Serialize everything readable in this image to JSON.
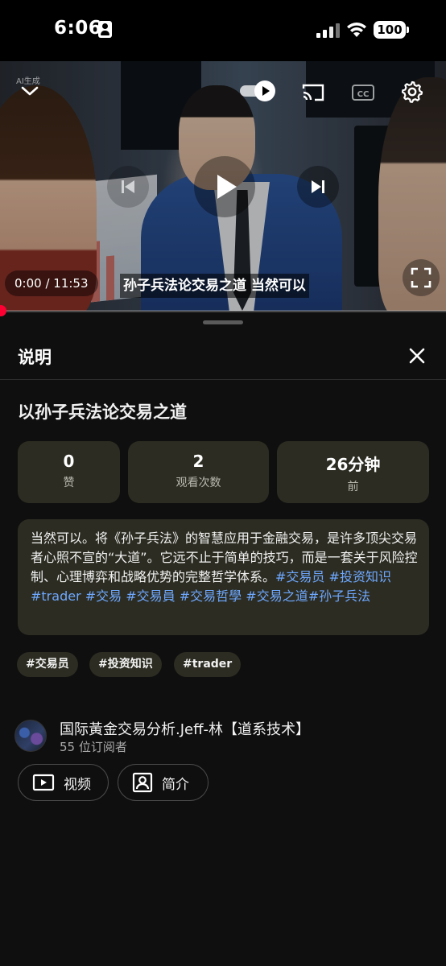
{
  "status_bar": {
    "time": "6:06",
    "battery": "100"
  },
  "player": {
    "ai_label": "AI生成",
    "time_display": "0:00 / 11:53",
    "subtitle": "孙子兵法论交易之道 当然可以",
    "progress": 0
  },
  "sheet": {
    "title": "说明",
    "video_title": "以孙子兵法论交易之道",
    "stats": [
      {
        "value": "0",
        "label": "赞"
      },
      {
        "value": "2",
        "label": "观看次数"
      },
      {
        "value": "26分钟",
        "label": "前"
      }
    ],
    "description": {
      "text": "当然可以。将《孙子兵法》的智慧应用于金融交易，是许多顶尖交易者心照不宣的“大道”。它远不止于简单的技巧，而是一套关于风险控制、心理博弈和战略优势的完整哲学体系。",
      "hashtags": [
        "#交易员",
        "#投资知识",
        "#trader",
        "#交易",
        "#交易員",
        "#交易哲學",
        "#交易之道",
        "#孙子兵法"
      ]
    },
    "chips": [
      "#交易员",
      "#投资知识",
      "#trader"
    ],
    "channel": {
      "name": "国际黃金交易分析.Jeff-林【道系技术】",
      "subscribers": "55 位订阅者"
    },
    "buttons": {
      "videos": "视频",
      "about": "简介"
    }
  },
  "colors": {
    "accent_red": "#ff0033",
    "hashtag_blue": "#6ea8ff",
    "card_bg": "#2c2c22",
    "page_bg": "#0f0f0f"
  }
}
